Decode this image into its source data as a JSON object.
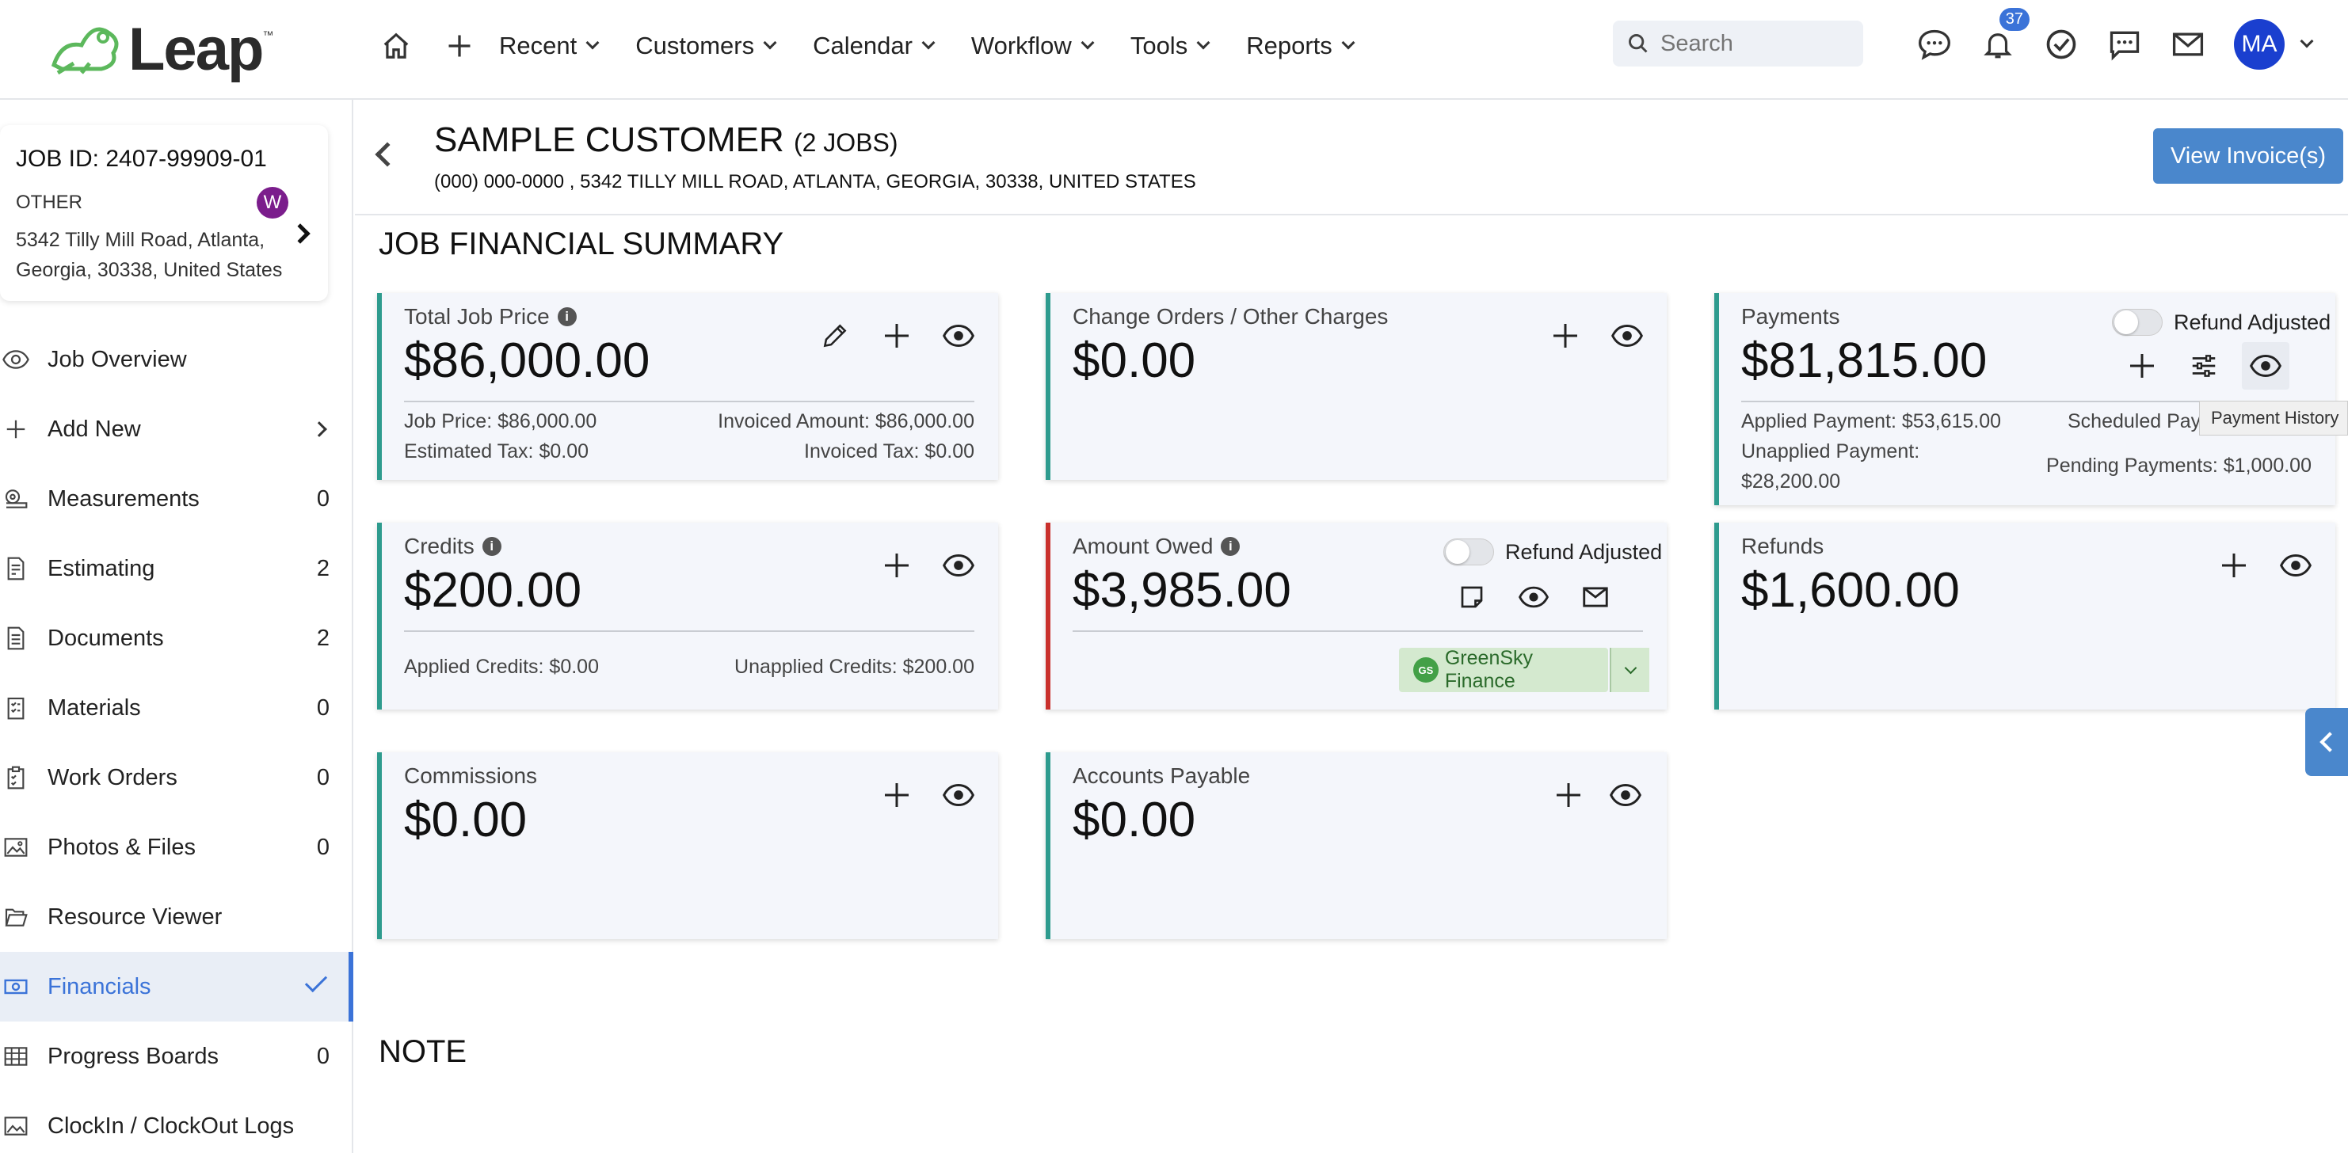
{
  "nav": {
    "logo": "Leap",
    "logo_tm": "™",
    "items": [
      "Recent",
      "Customers",
      "Calendar",
      "Workflow",
      "Tools",
      "Reports"
    ],
    "search_placeholder": "Search",
    "notification_count": "37",
    "avatar_initials": "MA"
  },
  "job": {
    "id": "JOB ID: 2407-99909-01",
    "type": "OTHER",
    "address": "5342 Tilly Mill Road, Atlanta, Georgia, 30338, United States",
    "assignee_initial": "W"
  },
  "sidebar": {
    "items": [
      {
        "label": "Job Overview",
        "count": ""
      },
      {
        "label": "Add New",
        "count": ""
      },
      {
        "label": "Measurements",
        "count": "0"
      },
      {
        "label": "Estimating",
        "count": "2"
      },
      {
        "label": "Documents",
        "count": "2"
      },
      {
        "label": "Materials",
        "count": "0"
      },
      {
        "label": "Work Orders",
        "count": "0"
      },
      {
        "label": "Photos & Files",
        "count": "0"
      },
      {
        "label": "Resource Viewer",
        "count": ""
      },
      {
        "label": "Financials",
        "count": ""
      },
      {
        "label": "Progress Boards",
        "count": "0"
      },
      {
        "label": "ClockIn / ClockOut Logs",
        "count": ""
      }
    ]
  },
  "header": {
    "customer_name": "SAMPLE CUSTOMER",
    "jobs_count": "(2 JOBS)",
    "contact": "(000) 000-0000 , 5342 TILLY MILL ROAD, ATLANTA, GEORGIA, 30338, UNITED STATES",
    "view_invoices": "View Invoice(s)"
  },
  "section_title": "JOB FINANCIAL SUMMARY",
  "cards": {
    "total_job_price": {
      "label": "Total Job Price",
      "amount": "$86,000.00",
      "job_price": "Job Price: $86,000.00",
      "invoiced_amount": "Invoiced Amount: $86,000.00",
      "estimated_tax": "Estimated Tax: $0.00",
      "invoiced_tax": "Invoiced Tax: $0.00"
    },
    "change_orders": {
      "label": "Change Orders / Other Charges",
      "amount": "$0.00"
    },
    "payments": {
      "label": "Payments",
      "amount": "$81,815.00",
      "refund_adjusted": "Refund Adjusted",
      "applied": "Applied Payment: $53,615.00",
      "scheduled": "Scheduled Pay",
      "unapplied_1": "Unapplied Payment:",
      "unapplied_2": "$28,200.00",
      "pending": "Pending Payments: $1,000.00",
      "tooltip": "Payment History"
    },
    "credits": {
      "label": "Credits",
      "amount": "$200.00",
      "applied": "Applied Credits: $0.00",
      "unapplied": "Unapplied Credits: $200.00"
    },
    "amount_owed": {
      "label": "Amount Owed",
      "amount": "$3,985.00",
      "refund_adjusted": "Refund Adjusted",
      "finance_button": "GreenSky Finance",
      "finance_logo": "GS"
    },
    "refunds": {
      "label": "Refunds",
      "amount": "$1,600.00"
    },
    "commissions": {
      "label": "Commissions",
      "amount": "$0.00"
    },
    "accounts_payable": {
      "label": "Accounts Payable",
      "amount": "$0.00"
    }
  },
  "note_title": "NOTE"
}
